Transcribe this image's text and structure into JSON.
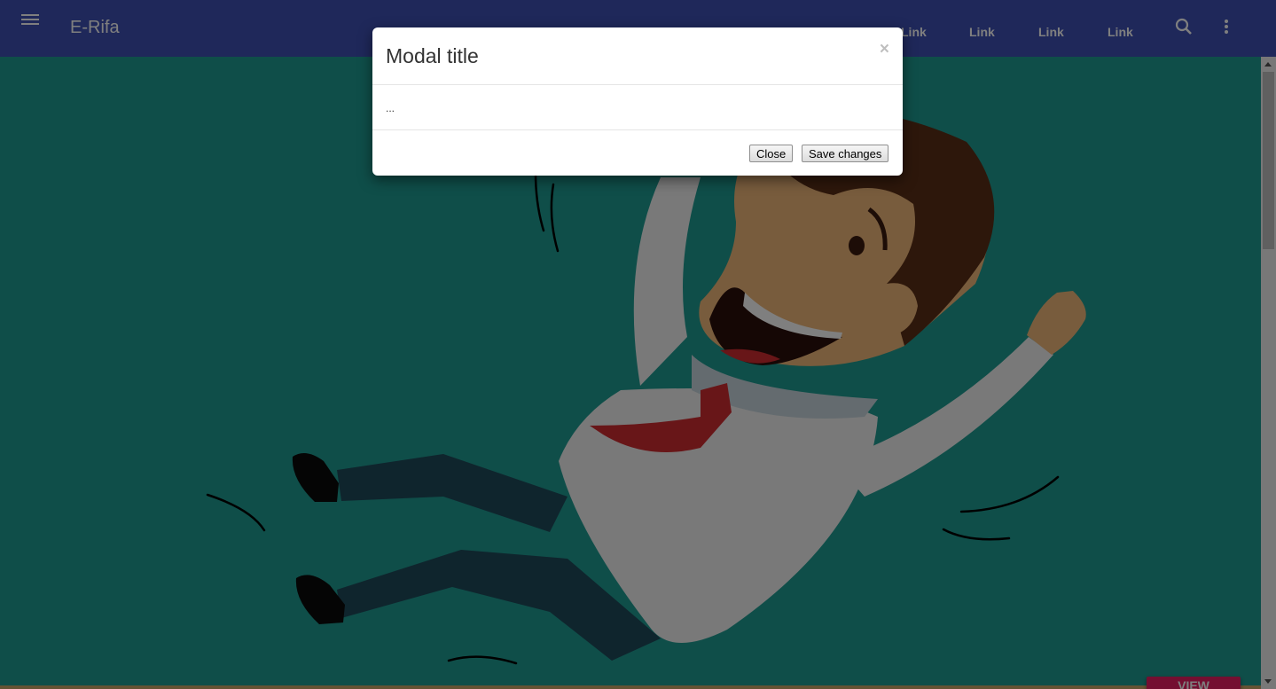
{
  "appbar": {
    "brand": "E-Rifa",
    "links": [
      "Link",
      "Link",
      "Link",
      "Link"
    ],
    "icons": [
      "menu-icon",
      "search-icon",
      "more-vert-icon"
    ]
  },
  "hero": {
    "view_source_label": "VIEW SOURCE"
  },
  "modal": {
    "title": "Modal title",
    "close_glyph": "×",
    "body": "...",
    "close_label": "Close",
    "save_label": "Save changes"
  },
  "colors": {
    "appbar": "#3f51b5",
    "hero_bg": "#1f9c92",
    "accent": "#e91e63",
    "backdrop": "rgba(0,0,0,0.5)"
  }
}
